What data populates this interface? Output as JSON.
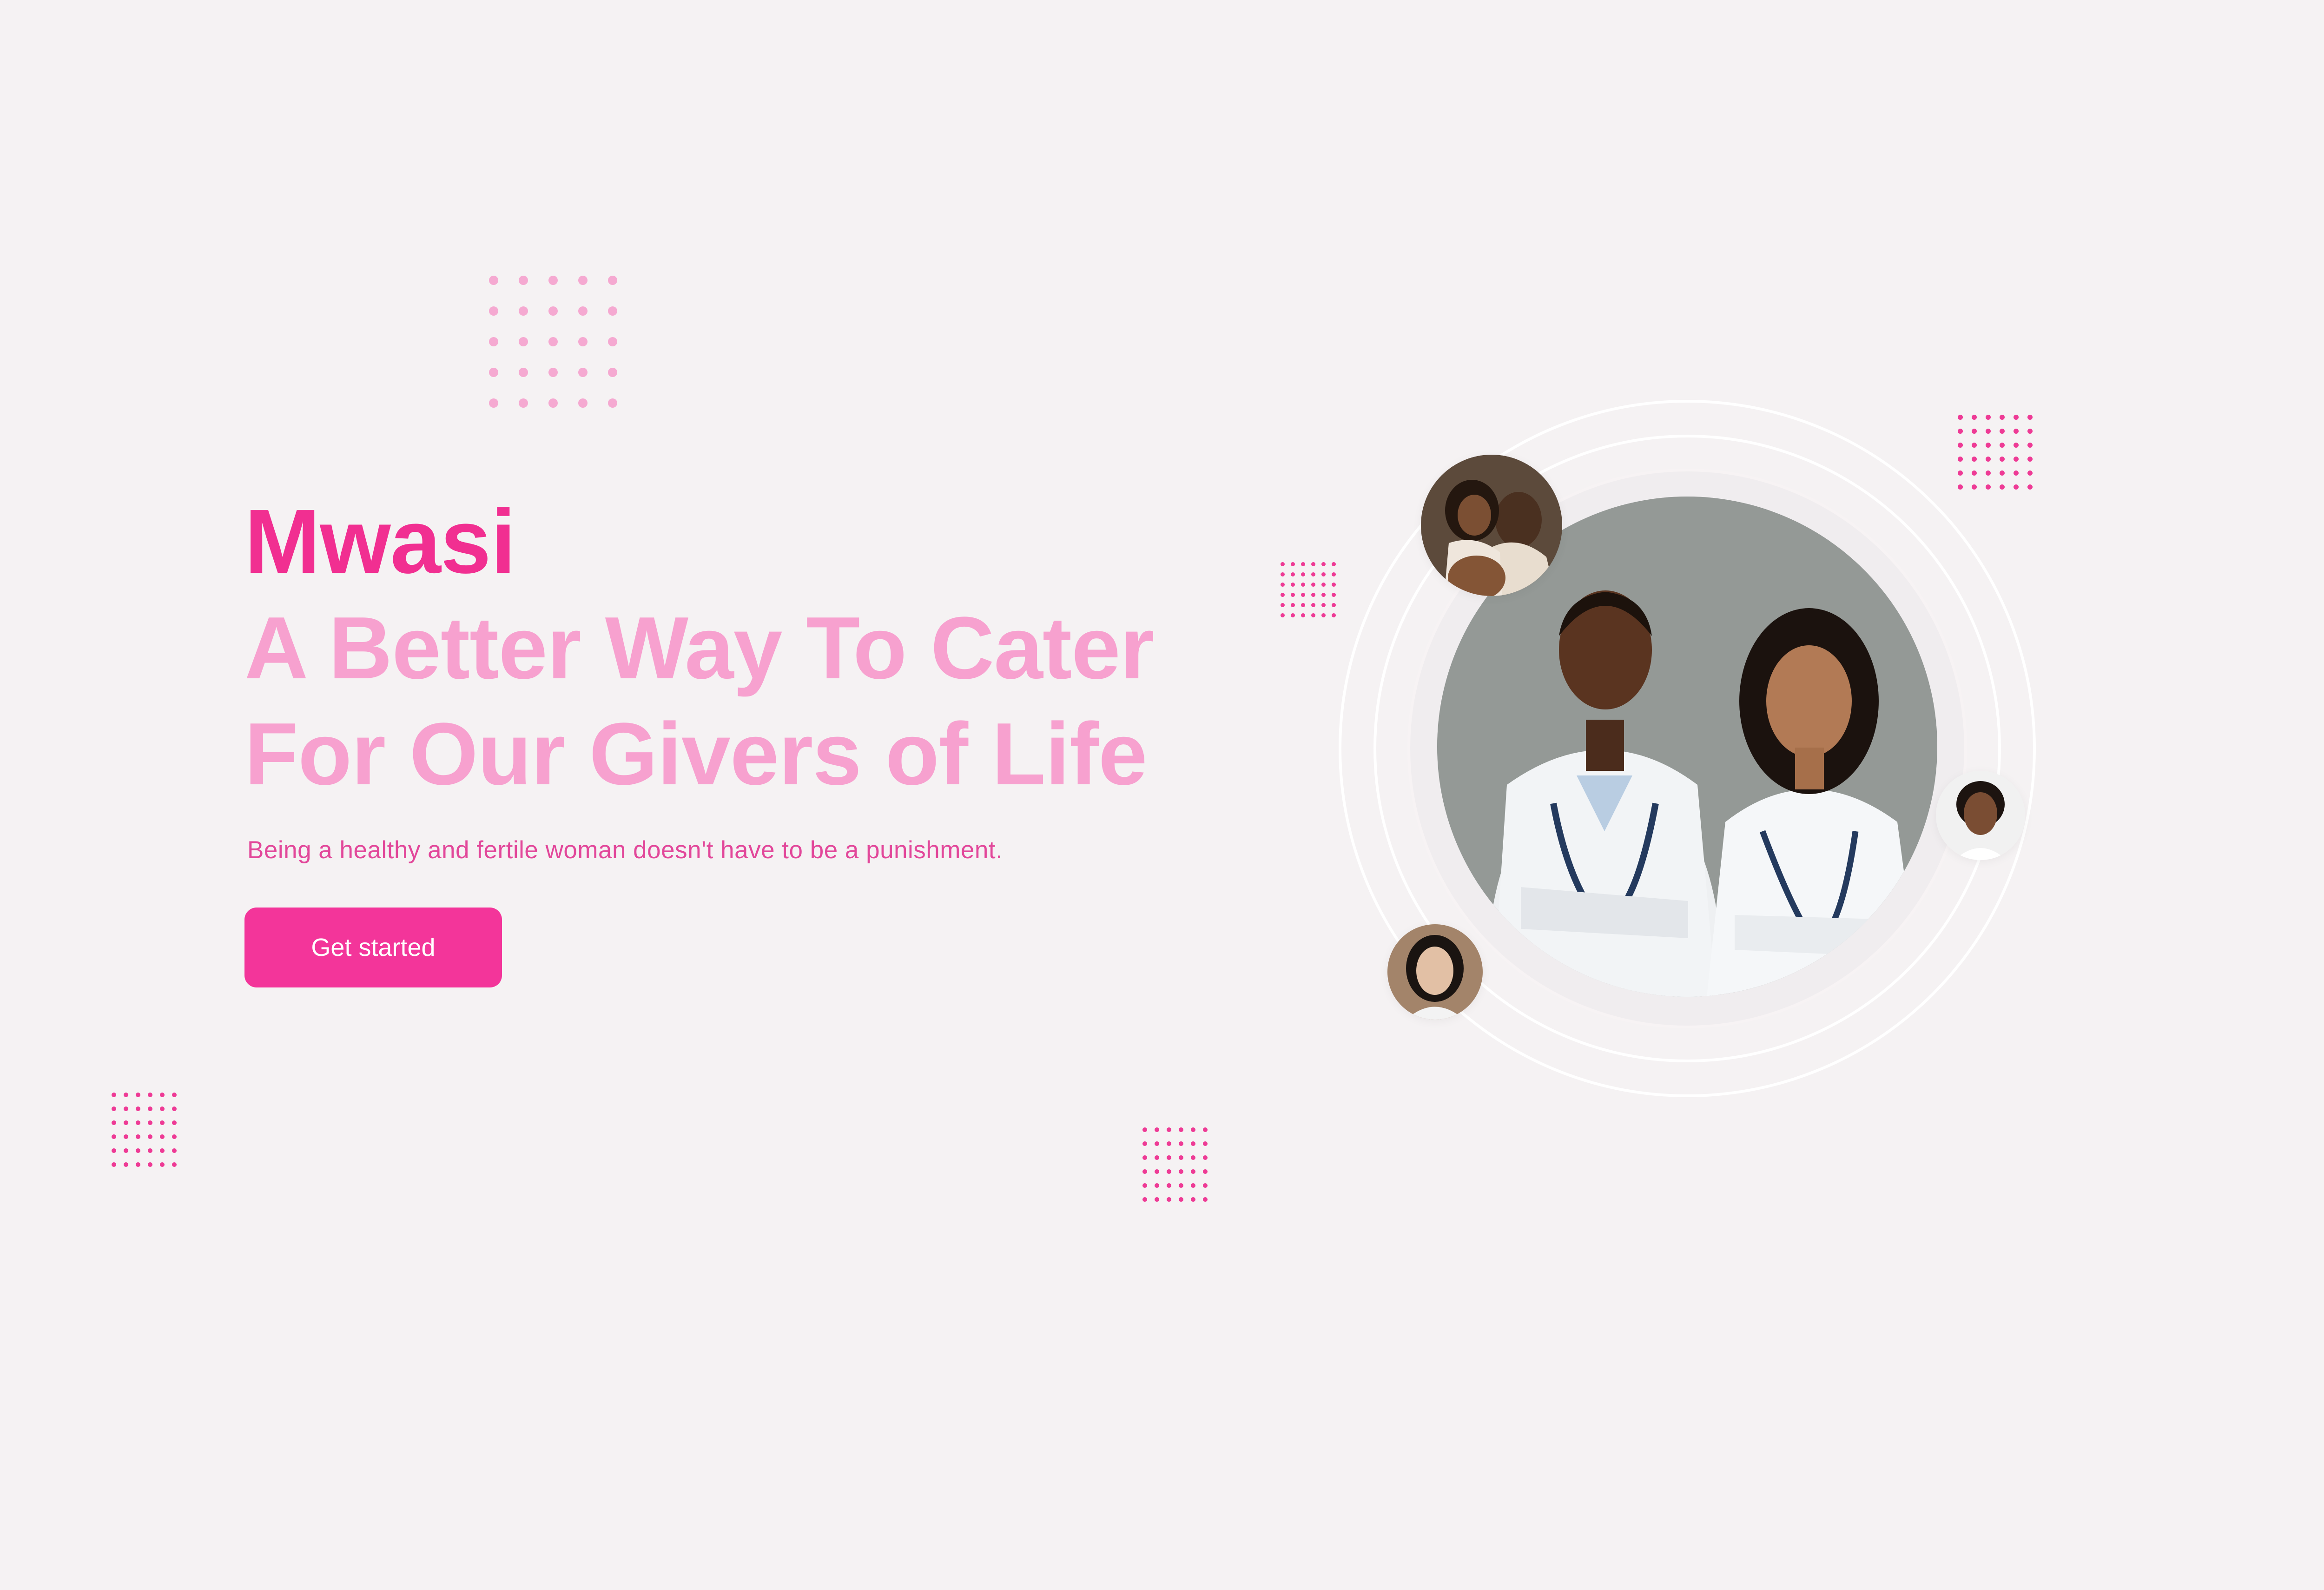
{
  "hero": {
    "brand": "Mwasi",
    "headline_line1": "A Better Way To Cater",
    "headline_line2": "For Our Givers of Life",
    "tagline": "Being a healthy and fertile woman doesn't have to be a punishment.",
    "cta_label": "Get started"
  },
  "colors": {
    "background": "#f5f2f3",
    "brand_pink": "#f12f91",
    "headline_pink": "#f7a1cf",
    "accent": "#f3359a"
  },
  "images": {
    "main_photo": "doctors-portrait",
    "avatar_1": "pregnant-couple-photo",
    "avatar_2": "woman-portrait-photo",
    "avatar_3": "woman-portrait-photo"
  }
}
